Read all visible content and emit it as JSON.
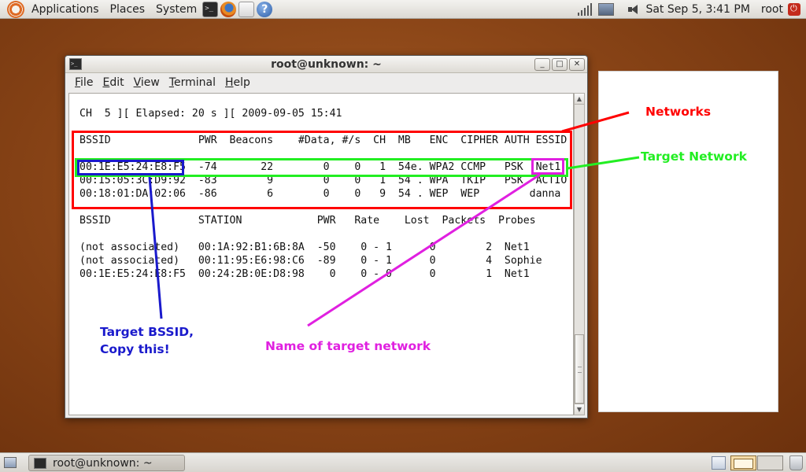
{
  "top_panel": {
    "menus": [
      "Applications",
      "Places",
      "System"
    ],
    "clock": "Sat Sep  5,  3:41 PM",
    "user": "root"
  },
  "window": {
    "title": "root@unknown: ~",
    "menubar": [
      "File",
      "Edit",
      "View",
      "Terminal",
      "Help"
    ],
    "terminal_lines": [
      "CH  5 ][ Elapsed: 20 s ][ 2009-09-05 15:41",
      "BSSID              PWR  Beacons    #Data, #/s  CH  MB   ENC  CIPHER AUTH ESSID",
      "00:1E:E5:24:E8:F5  -74       22        0    0   1  54e. WPA2 CCMP   PSK  Net1",
      "00:15:05:3C:D9:92  -83        9        0    0   1  54 . WPA  TKIP   PSK  ACTIO",
      "00:18:01:DA:02:06  -86        6        0    0   9  54 . WEP  WEP        danna",
      "BSSID              STATION            PWR   Rate    Lost  Packets  Probes",
      "(not associated)   00:1A:92:B1:6B:8A  -50    0 - 1      0        2  Net1",
      "(not associated)   00:11:95:E6:98:C6  -89    0 - 1      0        4  Sophie",
      "00:1E:E5:24:E8:F5  00:24:2B:0E:D8:98    0    0 - 0      0        1  Net1"
    ]
  },
  "annotations": {
    "networks": "Networks",
    "target_network": "Target Network",
    "target_bssid_line1": "Target BSSID,",
    "target_bssid_line2": "Copy this!",
    "name_of_target": "Name of target network",
    "colors": {
      "red": "#ff0000",
      "green": "#22ee22",
      "blue": "#1a1acc",
      "magenta": "#e020e0"
    }
  },
  "bottom_panel": {
    "task_label": "root@unknown: ~"
  },
  "icons": [
    "ubuntu-logo-icon",
    "terminal-icon",
    "firefox-icon",
    "mail-icon",
    "help-icon",
    "signal-icon",
    "network-icon",
    "volume-icon",
    "power-icon",
    "show-desktop-icon",
    "trash-icon"
  ]
}
